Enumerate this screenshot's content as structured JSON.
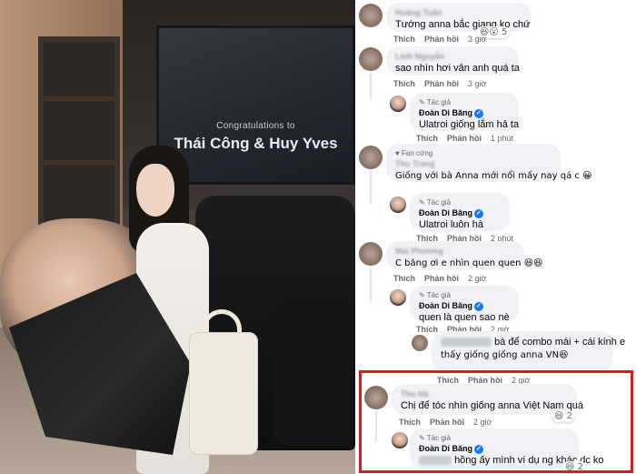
{
  "photo": {
    "tv_small": "Congratulations to",
    "tv_big": "Thái Công & Huy Yves"
  },
  "labels": {
    "like": "Thích",
    "reply": "Phản hồi",
    "author_badge": "Tác giả",
    "fan_badge": "Fan cứng"
  },
  "comments": [
    {
      "text": "Tướng anna bắc giang ko chứ",
      "time": "3 giờ",
      "reactions": "😆😮 5"
    },
    {
      "text": "sao nhìn hơi vân anh quá ta",
      "time": "3 giờ"
    },
    {
      "author": "Đoàn Di Băng",
      "text": "Ulatroi giống lắm hả ta",
      "time": "1 phút"
    },
    {
      "text": "Giống với bà Anna mới nổi mấy nay qá c 😀",
      "time": ""
    },
    {
      "author": "Đoàn Di Băng",
      "text": "Ulatroi luôn hà",
      "time": "2 phút"
    },
    {
      "text": "C băng ơi e nhìn quen quen 😆😆",
      "time": "2 giờ"
    },
    {
      "author": "Đoàn Di Băng",
      "text": "quen là quen sao nè",
      "time": "2 giờ"
    },
    {
      "text_line1": "bà để combo mái + cái kính e",
      "text_line2": "thấy giống giống anna VN😆",
      "time": "2 giờ"
    },
    {
      "text": "Chị để tóc nhìn giống anna Việt Nam quá",
      "time": "2 giờ",
      "reactions": "😆 2"
    },
    {
      "author": "Đoàn Di Băng",
      "text": "hồng ấy mình ví dụ ng khác dc ko",
      "time": "",
      "reactions": "😆 2"
    }
  ]
}
